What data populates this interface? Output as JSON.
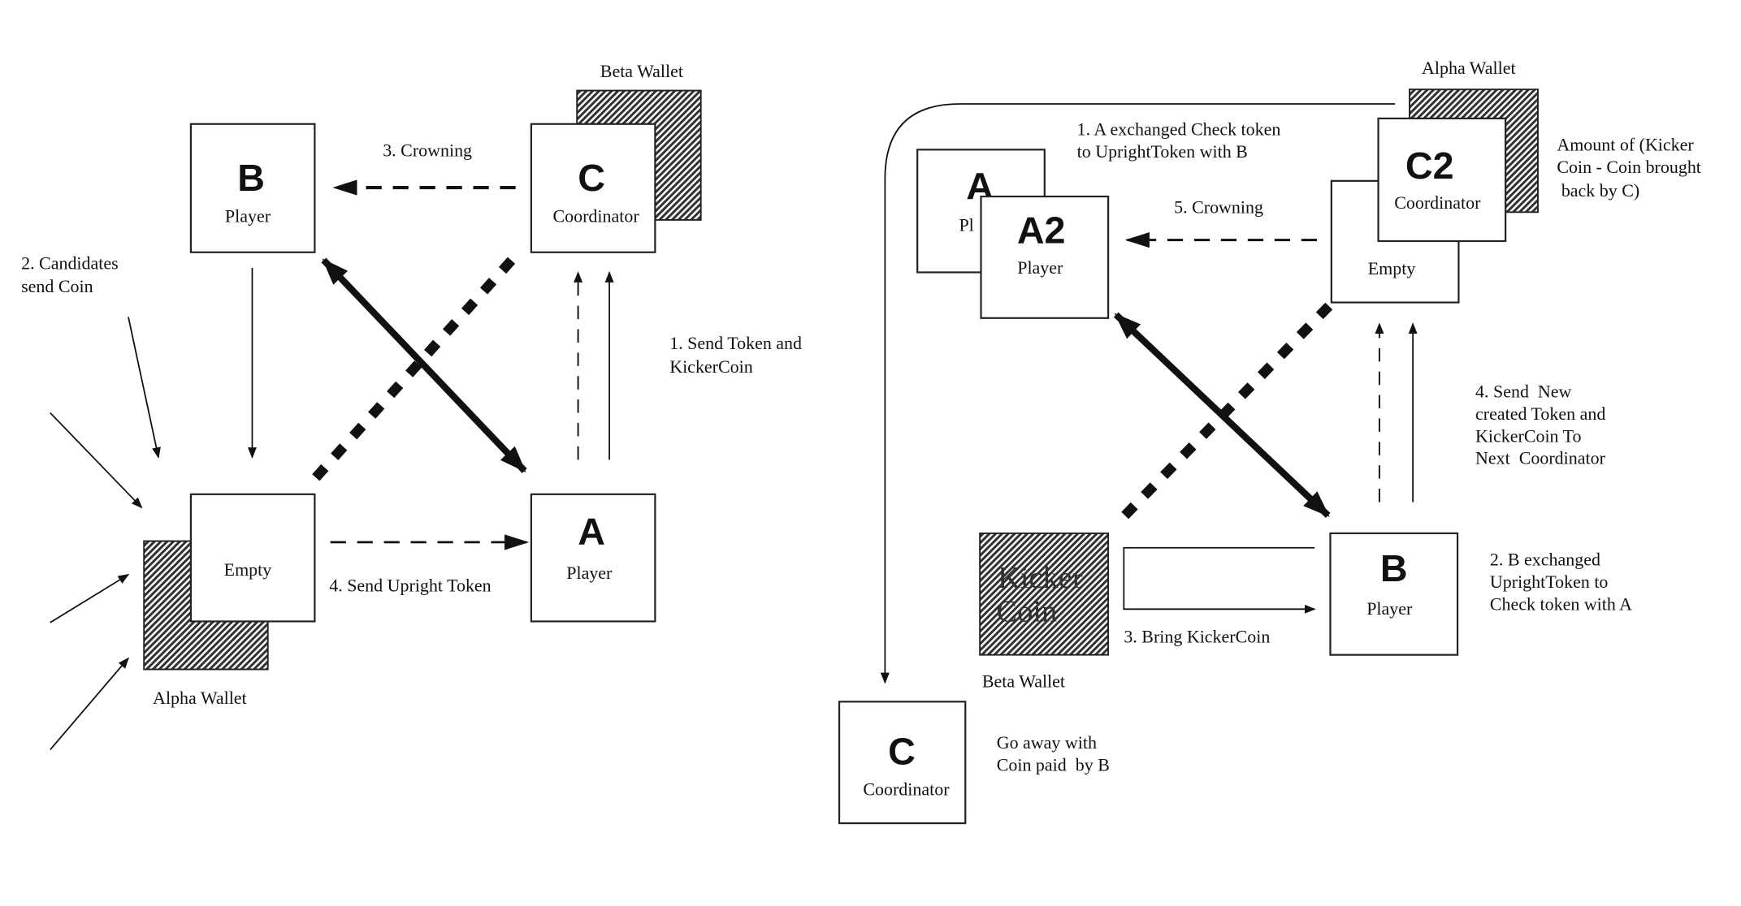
{
  "left_diagram": {
    "beta_wallet": "Beta Wallet",
    "alpha_wallet": "Alpha Wallet",
    "node_b": {
      "letter": "B",
      "role": "Player"
    },
    "node_c": {
      "letter": "C",
      "role": "Coordinator"
    },
    "node_empty": {
      "role": "Empty"
    },
    "node_a": {
      "letter": "A",
      "role": "Player"
    },
    "step1": [
      "1. Send Token and",
      "KickerCoin"
    ],
    "step2": [
      "2. Candidates",
      "send Coin"
    ],
    "step3": "3. Crowning",
    "step4": "4. Send Upright Token"
  },
  "right_diagram": {
    "alpha_wallet": "Alpha Wallet",
    "beta_wallet": "Beta Wallet",
    "node_a": {
      "letter": "A",
      "role": "Pl"
    },
    "node_a2": {
      "letter": "A2",
      "role": "Player"
    },
    "node_c2": {
      "letter": "C2",
      "role": "Coordinator"
    },
    "node_empty": {
      "role": "Empty"
    },
    "node_b": {
      "letter": "B",
      "role": "Player"
    },
    "node_c": {
      "letter": "C",
      "role": "Coordinator"
    },
    "kicker_coin": [
      "Kicker",
      "Coin"
    ],
    "amount_note": [
      "Amount of (Kicker",
      "Coin - Coin brought",
      " back by C)"
    ],
    "step1": [
      "1. A exchanged Check token",
      "to UprightToken with B"
    ],
    "step2": [
      "2. B exchanged",
      "UprightToken to",
      "Check token with A"
    ],
    "step3": "3. Bring KickerCoin",
    "step4": [
      "4. Send  New",
      "created Token and",
      "KickerCoin To",
      "Next  Coordinator"
    ],
    "step5": "5. Crowning",
    "go_away": [
      "Go away with",
      "Coin paid  by B"
    ]
  }
}
